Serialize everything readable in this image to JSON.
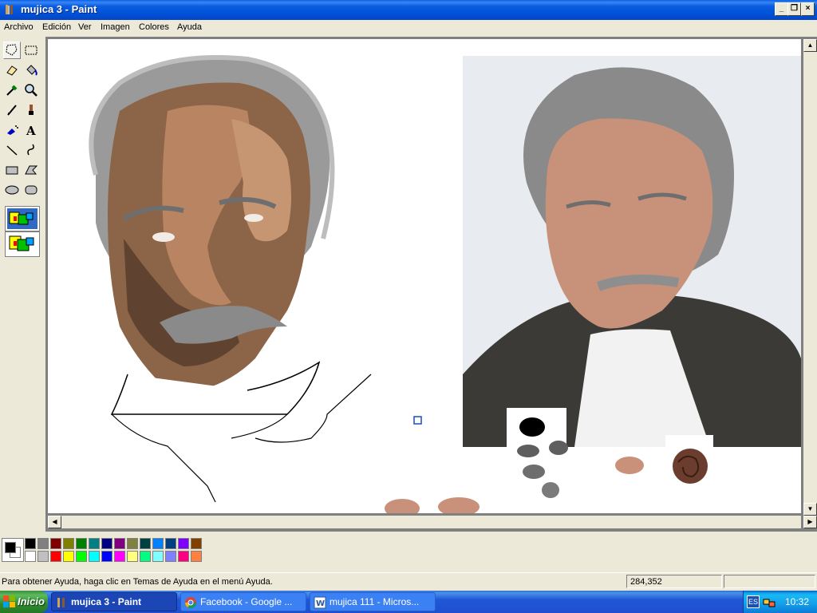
{
  "window": {
    "title": "mujica 3 - Paint"
  },
  "menu": [
    "Archivo",
    "Edición",
    "Ver",
    "Imagen",
    "Colores",
    "Ayuda"
  ],
  "toolbox": {
    "tools": [
      "free-form-select",
      "select",
      "eraser",
      "fill",
      "pick-color",
      "magnifier",
      "pencil",
      "brush",
      "airbrush",
      "text",
      "line",
      "curve",
      "rectangle",
      "polygon",
      "ellipse",
      "rounded-rectangle"
    ],
    "selected_tool": "free-form-select",
    "option_icons": [
      "transparent-option-icon",
      "opaque-option-icon"
    ]
  },
  "palette": {
    "foreground": "#000000",
    "background": "#ffffff",
    "top_row": [
      "#000000",
      "#808080",
      "#800000",
      "#808000",
      "#008000",
      "#008080",
      "#000080",
      "#800080",
      "#808040",
      "#004040",
      "#0080ff",
      "#004080",
      "#8000ff",
      "#804000"
    ],
    "bottom_row": [
      "#ffffff",
      "#c0c0c0",
      "#ff0000",
      "#ffff00",
      "#00ff00",
      "#00ffff",
      "#0000ff",
      "#ff00ff",
      "#ffff80",
      "#00ff80",
      "#80ffff",
      "#8080ff",
      "#ff0080",
      "#ff8040"
    ]
  },
  "status": {
    "help": "Para obtener Ayuda, haga clic en Temas de Ayuda en el menú Ayuda.",
    "coords": "284,352"
  },
  "taskbar": {
    "start": "Inicio",
    "tasks": [
      {
        "label": "mujica 3 - Paint",
        "active": true,
        "icon": "paint-icon"
      },
      {
        "label": "Facebook - Google ...",
        "active": false,
        "icon": "chrome-icon"
      },
      {
        "label": "mujica 111 - Micros...",
        "active": false,
        "icon": "word-icon"
      }
    ],
    "language": "ES",
    "clock": "10:32"
  }
}
